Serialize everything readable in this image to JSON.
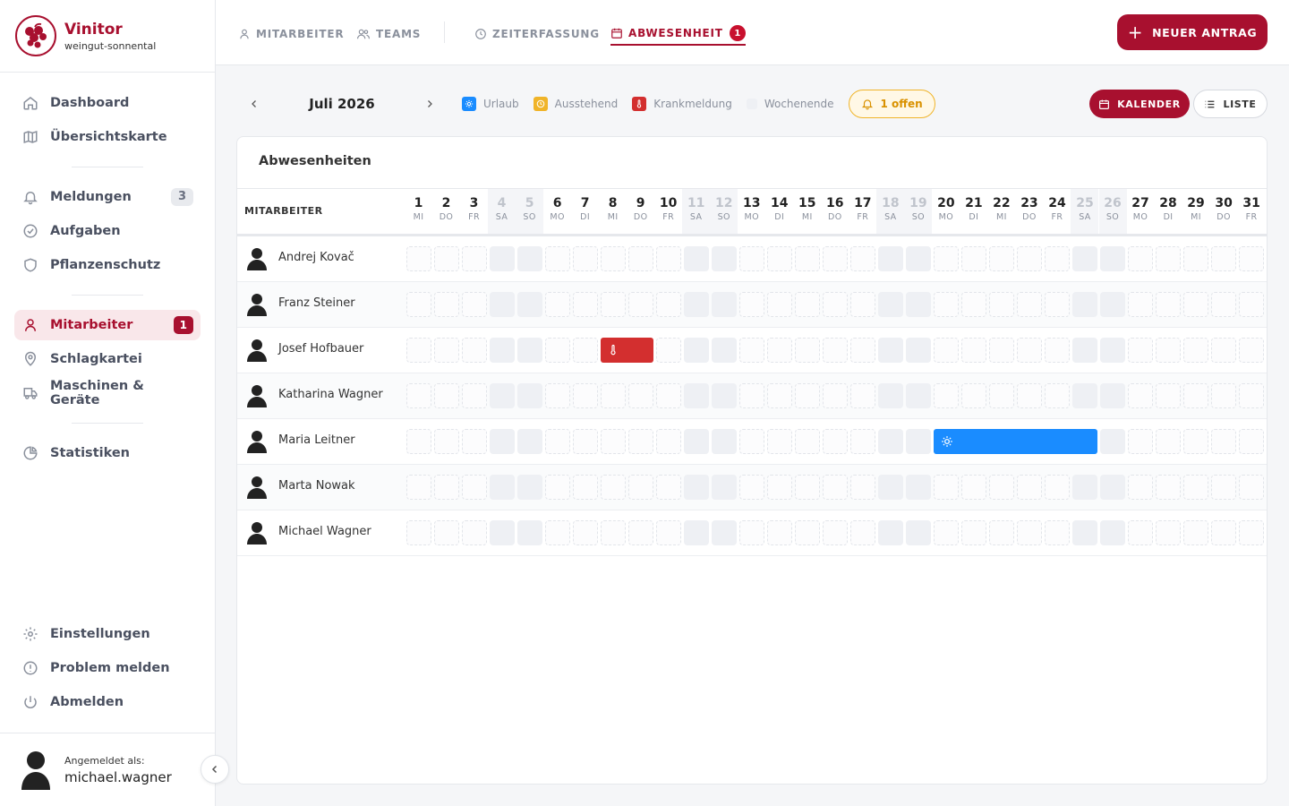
{
  "brand": {
    "name": "Vinitor",
    "subtitle": "weingut-sonnental"
  },
  "sidebar": {
    "items": [
      {
        "id": "dashboard",
        "label": "Dashboard",
        "icon": "home-icon"
      },
      {
        "id": "map",
        "label": "Übersichtskarte",
        "icon": "map-icon"
      },
      {
        "id": "alerts",
        "label": "Meldungen",
        "icon": "bell-icon",
        "badge": "3"
      },
      {
        "id": "tasks",
        "label": "Aufgaben",
        "icon": "check-circle-icon"
      },
      {
        "id": "plant",
        "label": "Pflanzenschutz",
        "icon": "shield-icon"
      },
      {
        "id": "staff",
        "label": "Mitarbeiter",
        "icon": "user-icon",
        "badge": "1"
      },
      {
        "id": "fields",
        "label": "Schlagkartei",
        "icon": "map-pin-icon"
      },
      {
        "id": "machines",
        "label": "Maschinen & Geräte",
        "icon": "truck-icon"
      },
      {
        "id": "stats",
        "label": "Statistiken",
        "icon": "pie-chart-icon"
      }
    ],
    "bottom": [
      {
        "id": "settings",
        "label": "Einstellungen",
        "icon": "gear-icon"
      },
      {
        "id": "report",
        "label": "Problem melden",
        "icon": "alert-circle-icon"
      },
      {
        "id": "logout",
        "label": "Abmelden",
        "icon": "power-icon"
      }
    ],
    "user": {
      "caption": "Angemeldet als:",
      "username": "michael.wagner"
    }
  },
  "tabs": [
    {
      "label": "MITARBEITER",
      "icon": "user-icon"
    },
    {
      "label": "TEAMS",
      "icon": "users-icon"
    },
    {
      "label": "ZEITERFASSUNG",
      "icon": "clock-icon"
    },
    {
      "label": "ABWESENHEIT",
      "icon": "calendar-icon",
      "badge": "1"
    }
  ],
  "new_request_label": "NEUER ANTRAG",
  "calendar": {
    "month": "Juli 2026",
    "legend": [
      {
        "label": "Urlaub",
        "color": "#1a8cff",
        "icon": "sun-icon"
      },
      {
        "label": "Ausstehend",
        "color": "#f0b429",
        "icon": "clock-icon"
      },
      {
        "label": "Krankmeldung",
        "color": "#d32f2f",
        "icon": "thermometer-icon"
      },
      {
        "label": "Wochenende",
        "color": "#eef0f4",
        "icon": ""
      }
    ],
    "open_label": "1 offen",
    "view_calendar": "KALENDER",
    "view_list": "LISTE",
    "card_title": "Abwesenheiten",
    "col_header": "MITARBEITER",
    "days": [
      {
        "n": "1",
        "w": "MI"
      },
      {
        "n": "2",
        "w": "DO"
      },
      {
        "n": "3",
        "w": "FR"
      },
      {
        "n": "4",
        "w": "SA"
      },
      {
        "n": "5",
        "w": "SO"
      },
      {
        "n": "6",
        "w": "MO"
      },
      {
        "n": "7",
        "w": "DI"
      },
      {
        "n": "8",
        "w": "MI"
      },
      {
        "n": "9",
        "w": "DO"
      },
      {
        "n": "10",
        "w": "FR"
      },
      {
        "n": "11",
        "w": "SA"
      },
      {
        "n": "12",
        "w": "SO"
      },
      {
        "n": "13",
        "w": "MO"
      },
      {
        "n": "14",
        "w": "DI"
      },
      {
        "n": "15",
        "w": "MI"
      },
      {
        "n": "16",
        "w": "DO"
      },
      {
        "n": "17",
        "w": "FR"
      },
      {
        "n": "18",
        "w": "SA"
      },
      {
        "n": "19",
        "w": "SO"
      },
      {
        "n": "20",
        "w": "MO"
      },
      {
        "n": "21",
        "w": "DI"
      },
      {
        "n": "22",
        "w": "MI"
      },
      {
        "n": "23",
        "w": "DO"
      },
      {
        "n": "24",
        "w": "FR"
      },
      {
        "n": "25",
        "w": "SA"
      },
      {
        "n": "26",
        "w": "SO"
      },
      {
        "n": "27",
        "w": "MO"
      },
      {
        "n": "28",
        "w": "DI"
      },
      {
        "n": "29",
        "w": "MI"
      },
      {
        "n": "30",
        "w": "DO"
      },
      {
        "n": "31",
        "w": "FR"
      }
    ],
    "employees": [
      {
        "name": "Andrej Kovač",
        "absences": []
      },
      {
        "name": "Franz Steiner",
        "absences": []
      },
      {
        "name": "Josef Hofbauer",
        "absences": [
          {
            "type": "Krankmeldung",
            "from": 8,
            "to": 9
          }
        ]
      },
      {
        "name": "Katharina Wagner",
        "absences": []
      },
      {
        "name": "Maria Leitner",
        "absences": [
          {
            "type": "Urlaub",
            "from": 20,
            "to": 25
          }
        ]
      },
      {
        "name": "Marta Nowak",
        "absences": []
      },
      {
        "name": "Michael Wagner",
        "absences": []
      }
    ]
  },
  "colors": {
    "accent": "#a8102f",
    "vacation": "#1a8cff",
    "sick": "#d32f2f",
    "pending": "#f0b429"
  }
}
